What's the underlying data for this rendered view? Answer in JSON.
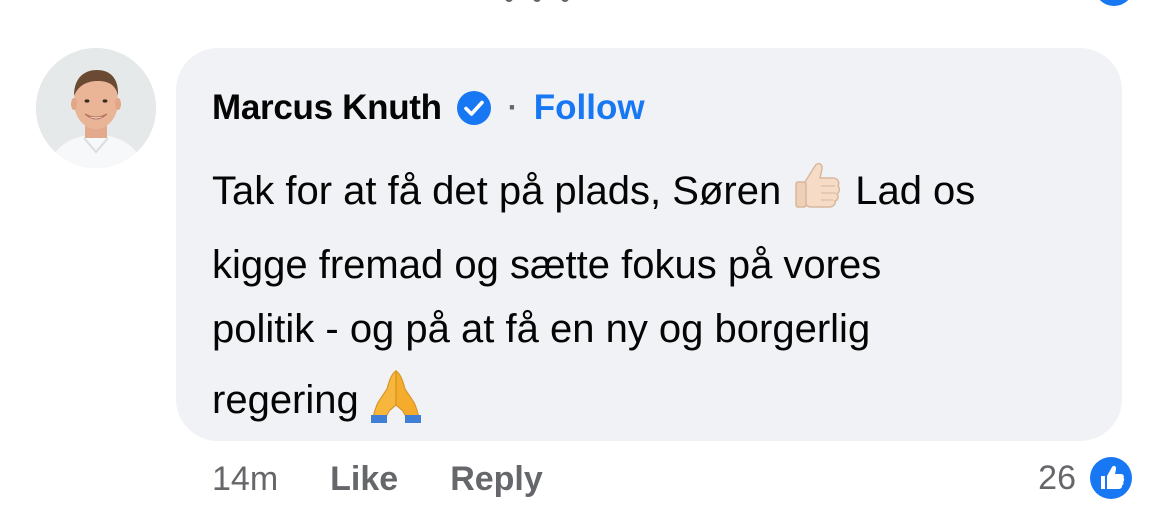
{
  "comment": {
    "author": "Marcus Knuth",
    "author_verified": true,
    "follow_label": "Follow",
    "separator": "·",
    "text_lines": [
      [
        "Tak for at få det på plads, Søren",
        "Lad os"
      ],
      "kigge fremad og sætte fokus på vores",
      "politik - og på at få en ny og borgerlig",
      "regering"
    ],
    "emojis": [
      "thumbs-up-light-skin-tone",
      "folded-hands"
    ],
    "timestamp": "14m",
    "like_label": "Like",
    "reply_label": "Reply",
    "reaction_count": "26",
    "reaction_type": "like"
  },
  "colors": {
    "accent": "#1877f2",
    "bubble": "#f0f2f5",
    "meta_text": "#65676b",
    "primary_text": "#050505"
  }
}
